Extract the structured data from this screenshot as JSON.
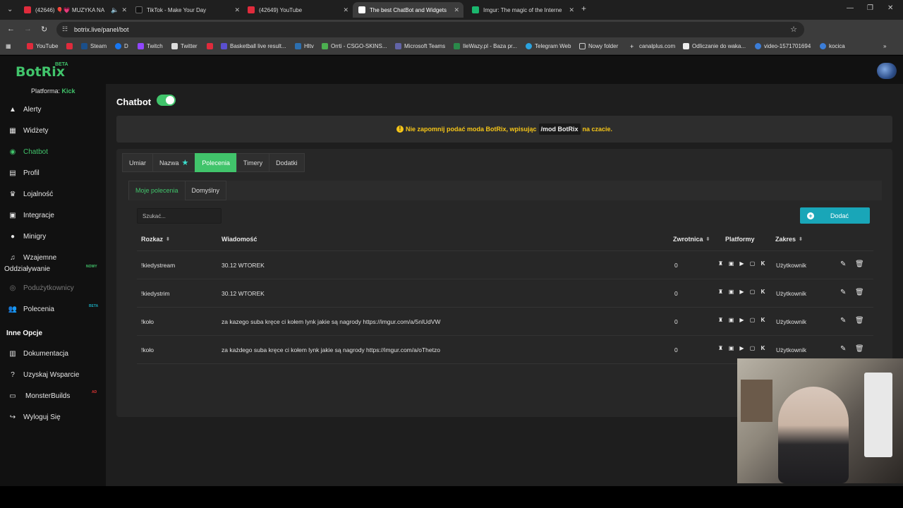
{
  "browser": {
    "tabs": [
      {
        "title": "(42646) 🎈💗 MUZYKA NA",
        "color": "#e02b3c"
      },
      {
        "title": "TikTok - Make Your Day",
        "color": "#111111"
      },
      {
        "title": "(42649) YouTube",
        "color": "#e02b3c"
      },
      {
        "title": "The best ChatBot and Widgets",
        "color": "#ffffff"
      },
      {
        "title": "Imgur: The magic of the Interne",
        "color": "#1bb76e"
      }
    ],
    "url": "botrix.live/panel/bot",
    "bookmarks": [
      {
        "label": "YouTube",
        "color": "#e02b3c"
      },
      {
        "label": "Steam",
        "color": "#1b4f8a"
      },
      {
        "label": "D",
        "color": "#1877f2"
      },
      {
        "label": "Twitch",
        "color": "#9146ff"
      },
      {
        "label": "Twitter",
        "color": "#dddddd"
      },
      {
        "label": "",
        "color": "#e02b3c"
      },
      {
        "label": "Basketball live result...",
        "color": "#5a4fcf"
      },
      {
        "label": "Hltv",
        "color": "#2c6fb0"
      },
      {
        "label": "Orrti - CSGO-SKINS...",
        "color": "#4caf50"
      },
      {
        "label": "Microsoft Teams",
        "color": "#6264a7"
      },
      {
        "label": "IleWazy.pl - Baza pr...",
        "color": "#2a8a4a"
      },
      {
        "label": "Telegram Web",
        "color": "#2aa3e0"
      },
      {
        "label": "Nowy folder",
        "color": "#cccccc"
      },
      {
        "label": "canalplus.com",
        "color": "#eeeeee"
      },
      {
        "label": "Odliczanie do waka...",
        "color": "#eeeeee"
      },
      {
        "label": "video-1571701694",
        "color": "#3b7dd8"
      },
      {
        "label": "kocica",
        "color": "#3b7dd8"
      }
    ]
  },
  "app": {
    "logo": "BotRix",
    "logo_beta": "BETA",
    "platform_label": "Platforma:",
    "platform_value": "Kick",
    "nav": [
      {
        "label": "Alerty",
        "icon": "warning-icon"
      },
      {
        "label": "Widżety",
        "icon": "grid-icon"
      },
      {
        "label": "Chatbot",
        "icon": "robot-icon"
      },
      {
        "label": "Profil",
        "icon": "id-card-icon"
      },
      {
        "label": "Lojalność",
        "icon": "trophy-icon"
      },
      {
        "label": "Integracje",
        "icon": "plug-icon"
      },
      {
        "label": "Minigry",
        "icon": "gamepad-icon"
      },
      {
        "label": "Wzajemne",
        "label2": "Oddziaływanie",
        "badge": "NOWY",
        "icon": "music-icon"
      },
      {
        "label": "Podużytkownicy",
        "icon": "users-icon"
      },
      {
        "label": "Polecenia",
        "badge": "BETA",
        "icon": "users-icon"
      }
    ],
    "section_title": "Inne Opcje",
    "other": [
      {
        "label": "Dokumentacja",
        "icon": "book-icon"
      },
      {
        "label": "Uzyskaj Wsparcie",
        "icon": "help-icon"
      },
      {
        "label": "MonsterBuilds",
        "badge": "AD",
        "icon": "monitor-icon"
      },
      {
        "label": "Wyloguj Się",
        "icon": "logout-icon"
      }
    ]
  },
  "page": {
    "title": "Chatbot",
    "enabled": true,
    "banner_before": "Nie zapomnij podać moda BotRix, wpisując",
    "banner_code": "/mod BotRix",
    "banner_after": "na czacie.",
    "tabs": [
      "Umiar",
      "Nazwa",
      "Polecenia",
      "Timery",
      "Dodatki"
    ],
    "active_tab": "Polecenia",
    "subtabs": [
      "Moje polecenia",
      "Domyślny"
    ],
    "search_placeholder": "Szukać...",
    "add_label": "Dodać",
    "columns": {
      "command": "Rozkaz",
      "message": "Wiadomość",
      "cooldown": "Zwrotnica",
      "platforms": "Platformy",
      "scope": "Zakres"
    },
    "rows": [
      {
        "command": "!kiedystream",
        "message": "30.12 WTOREK",
        "cooldown": "0",
        "scope": "Użytkownik"
      },
      {
        "command": "!kiedystrim",
        "message": "30.12 WTOREK",
        "cooldown": "0",
        "scope": "Użytkownik"
      },
      {
        "command": "!koło",
        "message": "za kazego suba kręce ci kołem lynk jakie są nagrody https://imgur.com/a/5nlUdVW",
        "cooldown": "0",
        "scope": "Użytkownik"
      },
      {
        "command": "!koło",
        "message": "za każdego suba kręce ci kołem lynk jakie są nagrody https://imgur.com/a/oThetzo",
        "cooldown": "0",
        "scope": "Użytkownik"
      }
    ]
  }
}
